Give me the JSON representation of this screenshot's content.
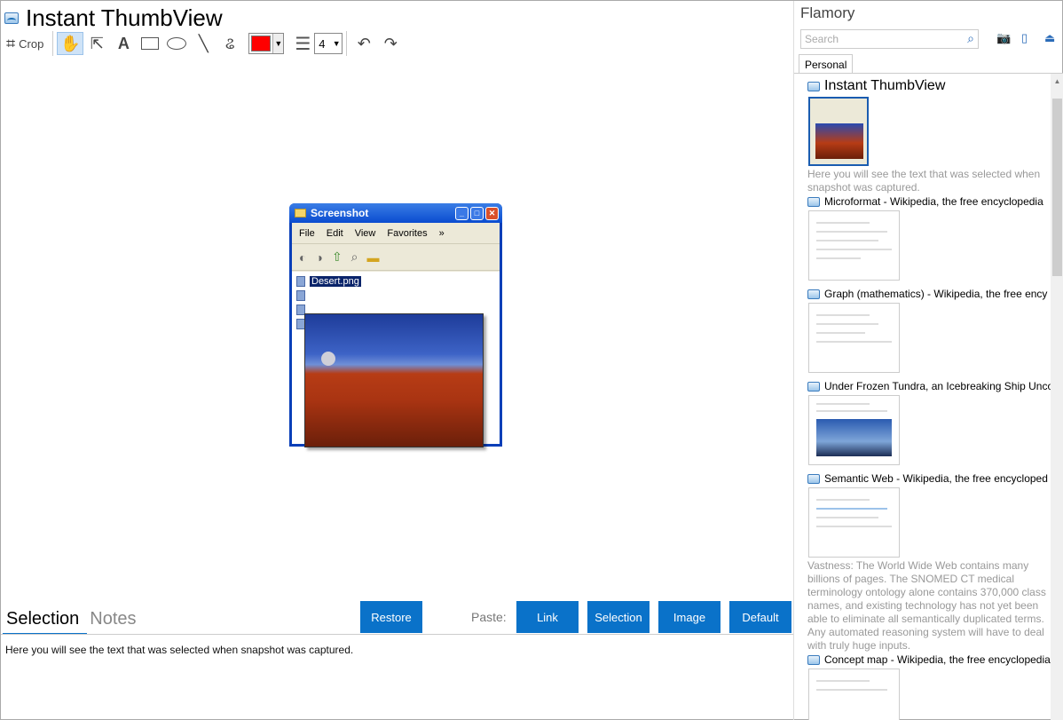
{
  "app": {
    "title": "Instant ThumbView"
  },
  "toolbar": {
    "crop_label": "Crop",
    "tools": [
      "hand-icon",
      "pointer-icon",
      "text-icon",
      "rectangle-icon",
      "ellipse-icon",
      "line-icon",
      "freehand-icon"
    ],
    "text_tool_label": "A",
    "color": "#ff0000",
    "line_width": "4"
  },
  "preview": {
    "window_title": "Screenshot",
    "menu": [
      "File",
      "Edit",
      "View",
      "Favorites"
    ],
    "file_label": "Desert.png"
  },
  "bottom": {
    "tabs": [
      "Selection",
      "Notes"
    ],
    "restore_label": "Restore",
    "paste_label": "Paste:",
    "paste_buttons": [
      "Link",
      "Selection",
      "Image",
      "Default"
    ],
    "selected_text": "Here you will see the text that was selected when snapshot was captured."
  },
  "sidebar": {
    "title": "Flamory",
    "search_placeholder": "Search",
    "tab": "Personal",
    "items": [
      {
        "title": "Instant ThumbView",
        "desc": "Here you will see the text that was selected when snapshot was captured."
      },
      {
        "title": "Microformat - Wikipedia, the free encyclopedia",
        "desc": ""
      },
      {
        "title": "Graph (mathematics) - Wikipedia, the free ency",
        "desc": ""
      },
      {
        "title": "Under Frozen Tundra, an Icebreaking Ship Unco",
        "desc": ""
      },
      {
        "title": "Semantic Web - Wikipedia, the free encycloped",
        "desc": "Vastness: The World Wide Web contains many billions of pages. The SNOMED CT medical terminology ontology alone contains 370,000 class names, and existing technology has not yet been able to eliminate all semantically duplicated terms. Any automated reasoning system will have to deal with truly huge inputs."
      },
      {
        "title": "Concept map - Wikipedia, the free encyclopedia",
        "desc": ""
      }
    ]
  }
}
